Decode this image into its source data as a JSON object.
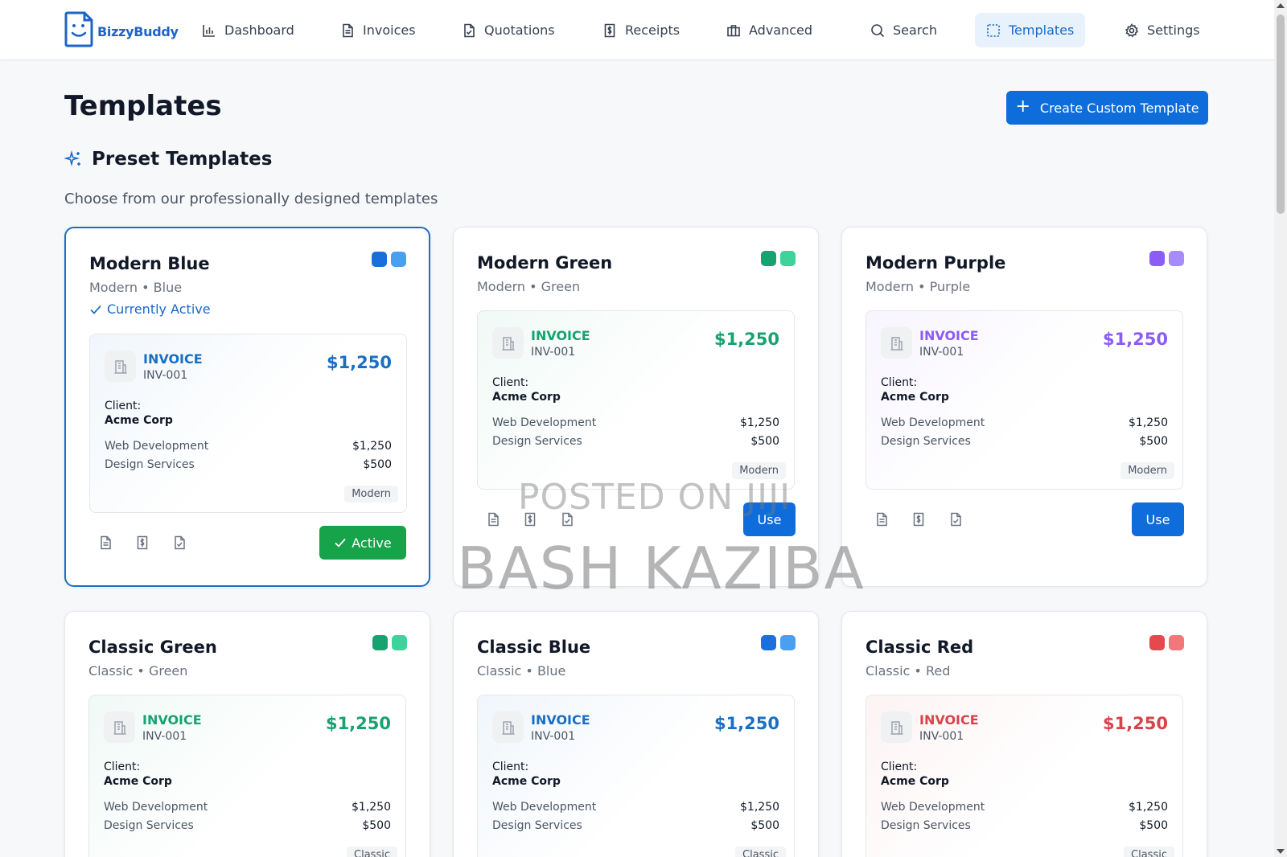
{
  "app": {
    "name": "BizzyBuddy",
    "brand_color": "#1769c8"
  },
  "nav": [
    {
      "label": "Dashboard",
      "icon": "bar-chart-icon",
      "active": false
    },
    {
      "label": "Invoices",
      "icon": "document-icon",
      "active": false
    },
    {
      "label": "Quotations",
      "icon": "file-check-icon",
      "active": false
    },
    {
      "label": "Receipts",
      "icon": "receipt-dollar-icon",
      "active": false
    },
    {
      "label": "Advanced",
      "icon": "briefcase-icon",
      "active": false
    },
    {
      "label": "Search",
      "icon": "search-icon",
      "active": true,
      "active_override": false
    },
    {
      "label": "Templates",
      "icon": "template-icon",
      "active": true
    },
    {
      "label": "Settings",
      "icon": "gear-icon",
      "active": false
    }
  ],
  "page": {
    "title": "Templates",
    "create_button": "Create Custom Template",
    "section_title": "Preset Templates",
    "section_subtitle": "Choose from our professionally designed templates"
  },
  "templates": [
    {
      "name": "Modern Blue",
      "meta": "Modern • Blue",
      "status": "Currently Active",
      "colors": [
        "#1a6fdc",
        "#4a9ff0"
      ],
      "accent": "#1a6fc4",
      "invoice": {
        "title": "INVOICE",
        "number": "INV-001",
        "amount": "$1,250",
        "client_label": "Client:",
        "client": "Acme Corp",
        "lines": [
          {
            "label": "Web Development",
            "amount": "$1,250"
          },
          {
            "label": "Design Services",
            "amount": "$500"
          }
        ],
        "tag": "Modern"
      },
      "button": "Active",
      "button_color": "#16a34a",
      "active": true
    },
    {
      "name": "Modern Green",
      "meta": "Modern • Green",
      "status": "",
      "colors": [
        "#16a370",
        "#3dd39a"
      ],
      "accent": "#16a370",
      "invoice": {
        "title": "INVOICE",
        "number": "INV-001",
        "amount": "$1,250",
        "client_label": "Client:",
        "client": "Acme Corp",
        "lines": [
          {
            "label": "Web Development",
            "amount": "$1,250"
          },
          {
            "label": "Design Services",
            "amount": "$500"
          }
        ],
        "tag": "Modern"
      },
      "button": "Use",
      "button_color": "#0f6ddb",
      "active": false
    },
    {
      "name": "Modern Purple",
      "meta": "Modern • Purple",
      "status": "",
      "colors": [
        "#8b5cf6",
        "#a78bfa"
      ],
      "accent": "#8b5cf6",
      "invoice": {
        "title": "INVOICE",
        "number": "INV-001",
        "amount": "$1,250",
        "client_label": "Client:",
        "client": "Acme Corp",
        "lines": [
          {
            "label": "Web Development",
            "amount": "$1,250"
          },
          {
            "label": "Design Services",
            "amount": "$500"
          }
        ],
        "tag": "Modern"
      },
      "button": "Use",
      "button_color": "#0f6ddb",
      "active": false
    },
    {
      "name": "Classic Green",
      "meta": "Classic • Green",
      "status": "",
      "colors": [
        "#16a370",
        "#3dd39a"
      ],
      "accent": "#16a370",
      "invoice": {
        "title": "INVOICE",
        "number": "INV-001",
        "amount": "$1,250",
        "client_label": "Client:",
        "client": "Acme Corp",
        "lines": [
          {
            "label": "Web Development",
            "amount": "$1,250"
          },
          {
            "label": "Design Services",
            "amount": "$500"
          }
        ],
        "tag": "Classic"
      },
      "button": "",
      "button_color": "",
      "active": false
    },
    {
      "name": "Classic Blue",
      "meta": "Classic • Blue",
      "status": "",
      "colors": [
        "#1a6fdc",
        "#4a9ff0"
      ],
      "accent": "#1a6fc4",
      "invoice": {
        "title": "INVOICE",
        "number": "INV-001",
        "amount": "$1,250",
        "client_label": "Client:",
        "client": "Acme Corp",
        "lines": [
          {
            "label": "Web Development",
            "amount": "$1,250"
          },
          {
            "label": "Design Services",
            "amount": "$500"
          }
        ],
        "tag": "Classic"
      },
      "button": "",
      "button_color": "",
      "active": false
    },
    {
      "name": "Classic Red",
      "meta": "Classic • Red",
      "status": "",
      "colors": [
        "#e5484d",
        "#f2777b"
      ],
      "accent": "#d9434a",
      "invoice": {
        "title": "INVOICE",
        "number": "INV-001",
        "amount": "$1,250",
        "client_label": "Client:",
        "client": "Acme Corp",
        "lines": [
          {
            "label": "Web Development",
            "amount": "$1,250"
          },
          {
            "label": "Design Services",
            "amount": "$500"
          }
        ],
        "tag": "Classic"
      },
      "button": "",
      "button_color": "",
      "active": false
    }
  ],
  "watermark": {
    "line1": "POSTED ON JIJI",
    "line2": "BASH KAZIBA"
  }
}
